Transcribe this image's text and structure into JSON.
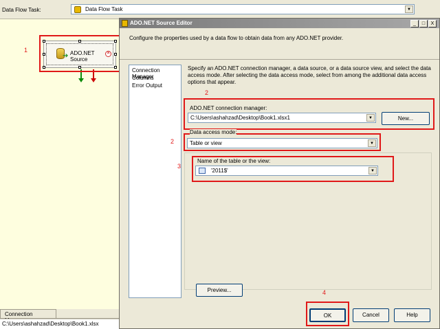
{
  "designer": {
    "task_label": "Data Flow Task:",
    "task_value": "Data Flow Task",
    "component": {
      "line1": "ADO.NET",
      "line2": "Source"
    },
    "connection_managers_tab": "Connection Managers",
    "connection_row": "C:\\Users\\ashahzad\\Desktop\\Book1.xlsx"
  },
  "dialog": {
    "title": "ADO.NET Source Editor",
    "title_buttons": {
      "minimize": "_",
      "maximize": "□",
      "close": "X"
    },
    "description": "Configure the properties used by a data flow to obtain data from any ADO.NET provider.",
    "nav": [
      "Connection Manager",
      "Columns",
      "Error Output"
    ],
    "main_description": "Specify an ADO.NET connection manager, a data source, or a data source view, and select the data access mode. After selecting the data access mode, select from among the additional data access options that appear.",
    "connection_manager_label": "ADO.NET connection manager:",
    "connection_manager_value": "C:\\Users\\ashahzad\\Desktop\\Book1.xlsx1",
    "new_button": "New...",
    "access_mode_label": "Data access mode:",
    "access_mode_value": "Table or view",
    "table_label": "Name of the table or the view:",
    "table_value": "'2011$'",
    "preview_button": "Preview...",
    "ok_button": "OK",
    "cancel_button": "Cancel",
    "help_button": "Help"
  },
  "annotations": {
    "n1": "1",
    "n2a": "2",
    "n2b": "2",
    "n3": "3",
    "n4": "4"
  },
  "colors": {
    "annotation": "#e01818",
    "designer_bg": "#fefedf",
    "dialog_bg": "#ece9d8"
  }
}
